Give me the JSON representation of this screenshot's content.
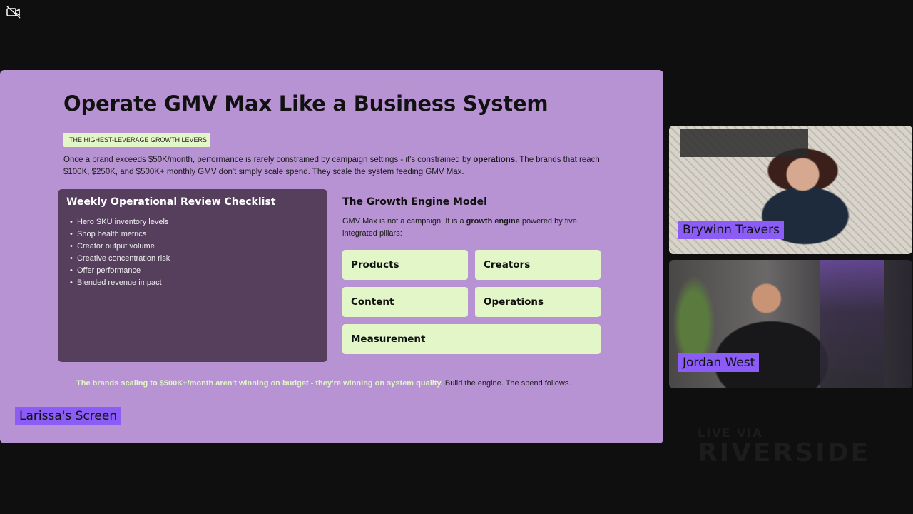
{
  "slide": {
    "title": "Operate GMV Max Like a Business System",
    "tag": "THE HIGHEST-LEVERAGE GROWTH LEVERS",
    "intro_parts": {
      "a": "Once a brand exceeds $50K/month, performance is rarely constrained by campaign settings  -  it's constrained by ",
      "b": "operations.",
      "c": " The brands that reach $100K, $250K, and $500K+ monthly GMV don't simply scale spend. They scale the system feeding GMV Max."
    },
    "checklist": {
      "title": "Weekly Operational Review Checklist",
      "items": [
        "Hero SKU inventory levels",
        "Shop health metrics",
        "Creator output volume",
        "Creative concentration risk",
        "Offer performance",
        "Blended revenue impact"
      ]
    },
    "engine": {
      "title": "The Growth Engine Model",
      "desc_a": "GMV Max is not a campaign. It is a ",
      "desc_b": "growth engine",
      "desc_c": " powered by five integrated pillars:",
      "pillars": [
        "Products",
        "Creators",
        "Content",
        "Operations",
        "Measurement"
      ]
    },
    "footer": {
      "highlight": "The brands scaling to $500K+/month aren't winning on budget  -  they're winning on system quality.",
      "rest": " Build the engine. The spend follows."
    }
  },
  "screen_label": "Larissa's Screen",
  "participants": [
    {
      "name": "Brywinn Travers"
    },
    {
      "name": "Jordan West"
    }
  ],
  "watermark": {
    "top": "LIVE VIA",
    "bottom": "RIVERSIDE"
  },
  "icons": {
    "camera_off": "video-off-icon"
  },
  "colors": {
    "slide_bg": "#b893d3",
    "accent_green": "#e2f6c8",
    "panel": "#553f5d",
    "name_tag": "#8b5cf6"
  }
}
